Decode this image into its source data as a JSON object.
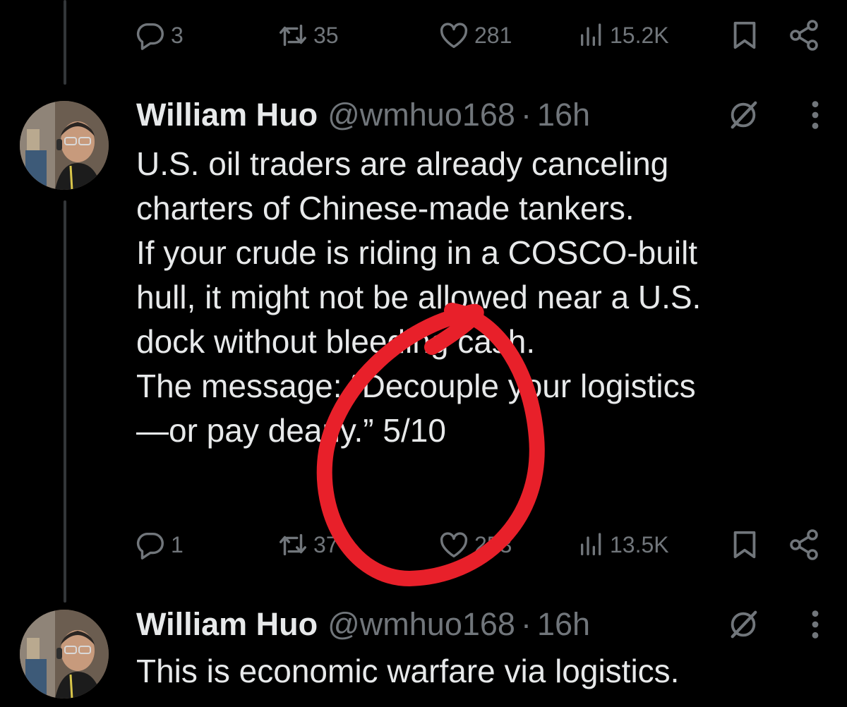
{
  "top_actions": {
    "replies": "3",
    "reposts": "35",
    "likes": "281",
    "views": "15.2K"
  },
  "tweet1": {
    "author_name": "William Huo",
    "handle": "@wmhuo168",
    "separator": "·",
    "time": "16h",
    "lines": [
      "U.S. oil traders are already canceling",
      "charters of Chinese-made tankers.",
      "If your crude is riding in a COSCO-built",
      "hull, it might not be allowed near a U.S.",
      "dock without bleeding cash.",
      "The message: “Decouple your logistics",
      "—or pay dearly.” 5/10"
    ],
    "actions": {
      "replies": "1",
      "reposts": "37",
      "likes": "253",
      "views": "13.5K"
    }
  },
  "tweet2": {
    "author_name": "William Huo",
    "handle": "@wmhuo168",
    "separator": "·",
    "time": "16h",
    "lines": [
      "This is economic warfare via logistics."
    ]
  },
  "icons": {
    "reply": "reply-icon",
    "repost": "repost-icon",
    "like": "heart-icon",
    "views": "views-icon",
    "bookmark": "bookmark-icon",
    "share": "share-icon",
    "grok": "grok-icon",
    "more": "more-icon"
  },
  "colors": {
    "background": "#000000",
    "text": "#e7e9ea",
    "muted": "#71767b",
    "annotation": "#e8202a"
  }
}
